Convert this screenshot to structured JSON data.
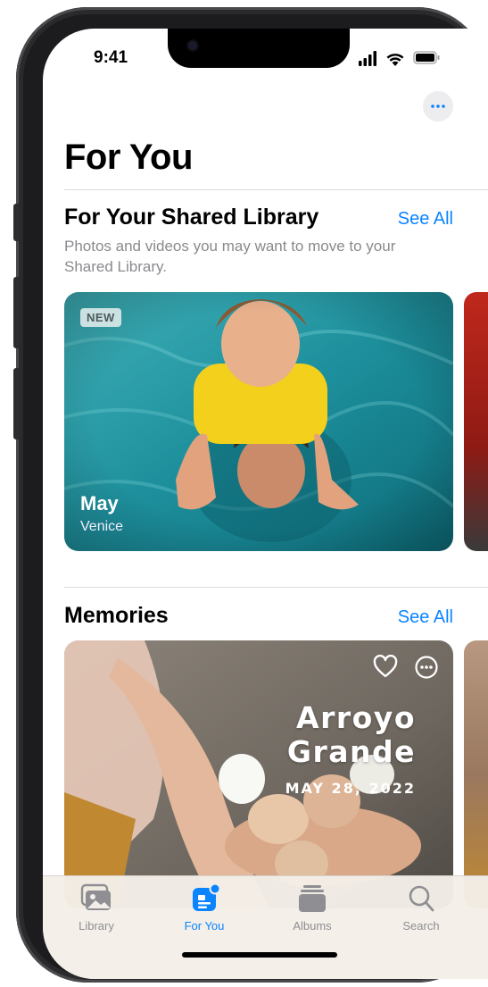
{
  "status_bar": {
    "time": "9:41"
  },
  "header": {
    "title": "For You",
    "more_icon": "ellipsis-icon"
  },
  "shared_library": {
    "title": "For Your Shared Library",
    "see_all": "See All",
    "subtitle": "Photos and videos you may want to move to your Shared Library.",
    "card": {
      "badge": "NEW",
      "title": "May",
      "location": "Venice"
    }
  },
  "memories": {
    "title": "Memories",
    "see_all": "See All",
    "card": {
      "title": "Arroyo Grande",
      "date": "MAY 28, 2022",
      "favorite_icon": "heart-icon",
      "more_icon": "ellipsis-circle-icon"
    }
  },
  "tab_bar": {
    "active": "For You",
    "accent_color": "#0a84ff",
    "tabs": [
      {
        "label": "Library",
        "icon": "photo-library-icon"
      },
      {
        "label": "For You",
        "icon": "for-you-icon"
      },
      {
        "label": "Albums",
        "icon": "albums-icon"
      },
      {
        "label": "Search",
        "icon": "search-icon"
      }
    ]
  }
}
